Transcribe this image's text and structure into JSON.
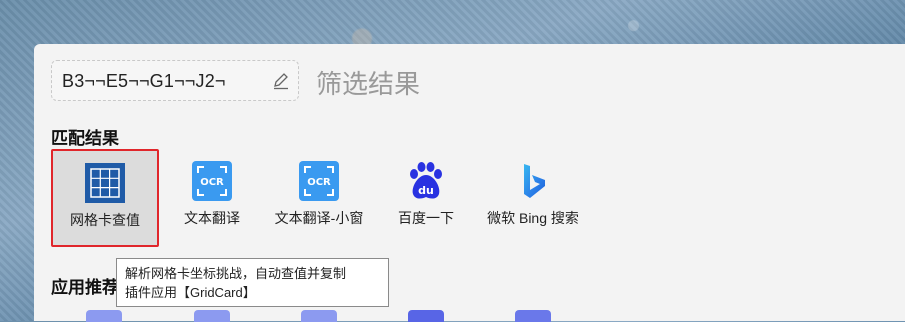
{
  "search": {
    "value": "B3¬¬E5¬¬G1¬¬J2¬",
    "filter_label": "筛选结果"
  },
  "sections": {
    "match_title": "匹配结果",
    "recommend_title": "应用推荐"
  },
  "results": [
    {
      "label": "网格卡查值",
      "icon": "grid-icon"
    },
    {
      "label": "文本翻译",
      "icon": "ocr-icon"
    },
    {
      "label": "文本翻译-小窗",
      "icon": "ocr-icon"
    },
    {
      "label": "百度一下",
      "icon": "baidu-icon"
    },
    {
      "label": "微软 Bing 搜索",
      "icon": "bing-icon"
    }
  ],
  "tooltip": {
    "line1": "解析网格卡坐标挑战，自动查值并复制",
    "line2": "插件应用【GridCard】"
  },
  "colors": {
    "selection_border": "#e0262b",
    "grid_icon": "#1f5ba7",
    "ocr_icon": "#3a9af0",
    "baidu": "#2932e1",
    "recommend_icon": "#7b8cf0"
  }
}
